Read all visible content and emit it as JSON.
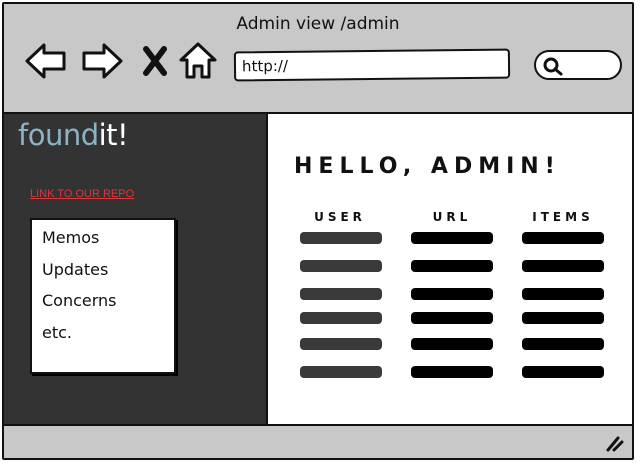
{
  "window": {
    "title": "Admin view /admin"
  },
  "toolbar": {
    "url_value": "http://",
    "icons": [
      "back-arrow-icon",
      "forward-arrow-icon",
      "close-icon",
      "home-icon",
      "search-icon"
    ]
  },
  "sidebar": {
    "logo_part1": "found",
    "logo_part2": "it!",
    "repo_link": "LINK TO OUR REPO",
    "items": [
      {
        "label": "Memos"
      },
      {
        "label": "Updates"
      },
      {
        "label": "Concerns"
      },
      {
        "label": "etc."
      }
    ]
  },
  "main": {
    "heading": "HELLO, ADMIN!",
    "columns": [
      "USER",
      "URL",
      "ITEMS"
    ],
    "placeholder_rows": 6
  },
  "colors": {
    "logo_found": "#8cb3c4",
    "logo_it": "#ffffff",
    "link": "#e0353b",
    "sidebar_bg": "#333333",
    "chrome_bg": "#c8c8c8"
  }
}
